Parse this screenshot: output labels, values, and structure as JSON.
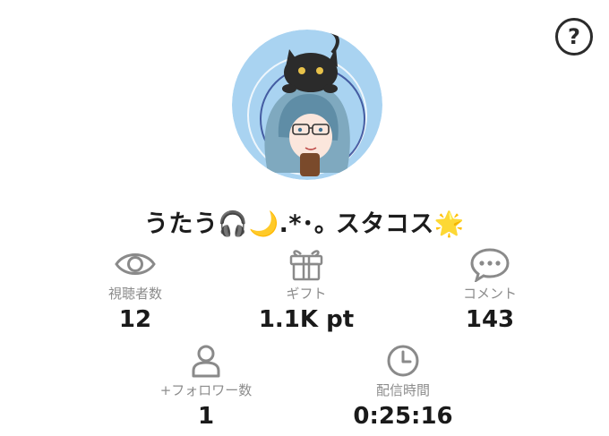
{
  "help": {
    "symbol": "?"
  },
  "profile": {
    "display_name": "うたう🎧🌙.*･｡ スタコス🌟",
    "avatar_icon": "avatar-image"
  },
  "stats": {
    "viewers": {
      "label": "視聴者数",
      "value": "12",
      "icon": "eye-icon"
    },
    "gifts": {
      "label": "ギフト",
      "value": "1.1K pt",
      "icon": "gift-icon"
    },
    "comments": {
      "label": "コメント",
      "value": "143",
      "icon": "comment-bubble-icon"
    },
    "followers": {
      "label": "+フォロワー数",
      "value": "1",
      "icon": "person-icon"
    },
    "duration": {
      "label": "配信時間",
      "value": "0:25:16",
      "icon": "clock-icon"
    }
  },
  "colors": {
    "icon_gray": "#8a8a8a",
    "label_gray": "#8c8c8c",
    "value_text": "#1a1a1a",
    "avatar_bg": "#a9d3f1"
  }
}
